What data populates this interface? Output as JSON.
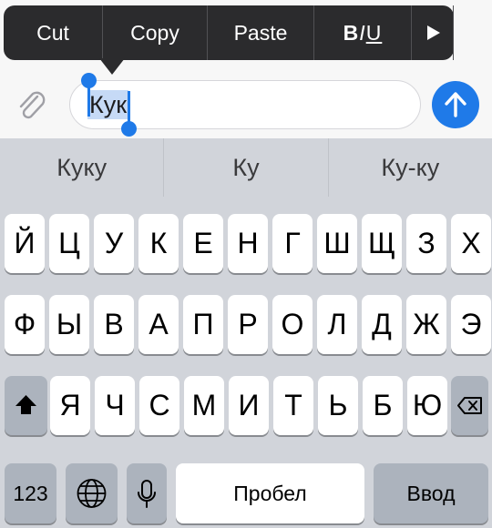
{
  "edit_menu": {
    "cut": "Cut",
    "copy": "Copy",
    "paste": "Paste",
    "format_b": "B",
    "format_i": "I",
    "format_u": "U",
    "more_icon": "play-triangle-icon"
  },
  "input": {
    "value": "Кук",
    "attach_icon": "paperclip-icon",
    "send_icon": "arrow-up-icon"
  },
  "suggestions": [
    "Куку",
    "Ку",
    "Ку-ку"
  ],
  "keyboard": {
    "row1": [
      "Й",
      "Ц",
      "У",
      "К",
      "Е",
      "Н",
      "Г",
      "Ш",
      "Щ",
      "З",
      "Х"
    ],
    "row2": [
      "Ф",
      "Ы",
      "В",
      "А",
      "П",
      "Р",
      "О",
      "Л",
      "Д",
      "Ж",
      "Э"
    ],
    "row3": [
      "Я",
      "Ч",
      "С",
      "М",
      "И",
      "Т",
      "Ь",
      "Б",
      "Ю"
    ],
    "numbers_label": "123",
    "space_label": "Пробел",
    "return_label": "Ввод",
    "icons": {
      "shift": "shift-icon",
      "backspace": "backspace-icon",
      "globe": "globe-icon",
      "mic": "microphone-icon"
    }
  },
  "colors": {
    "accent": "#1f7ae8",
    "keyboard_bg": "#d1d4da",
    "menu_bg": "#2b2b2d",
    "selection": "#c6daf6"
  }
}
